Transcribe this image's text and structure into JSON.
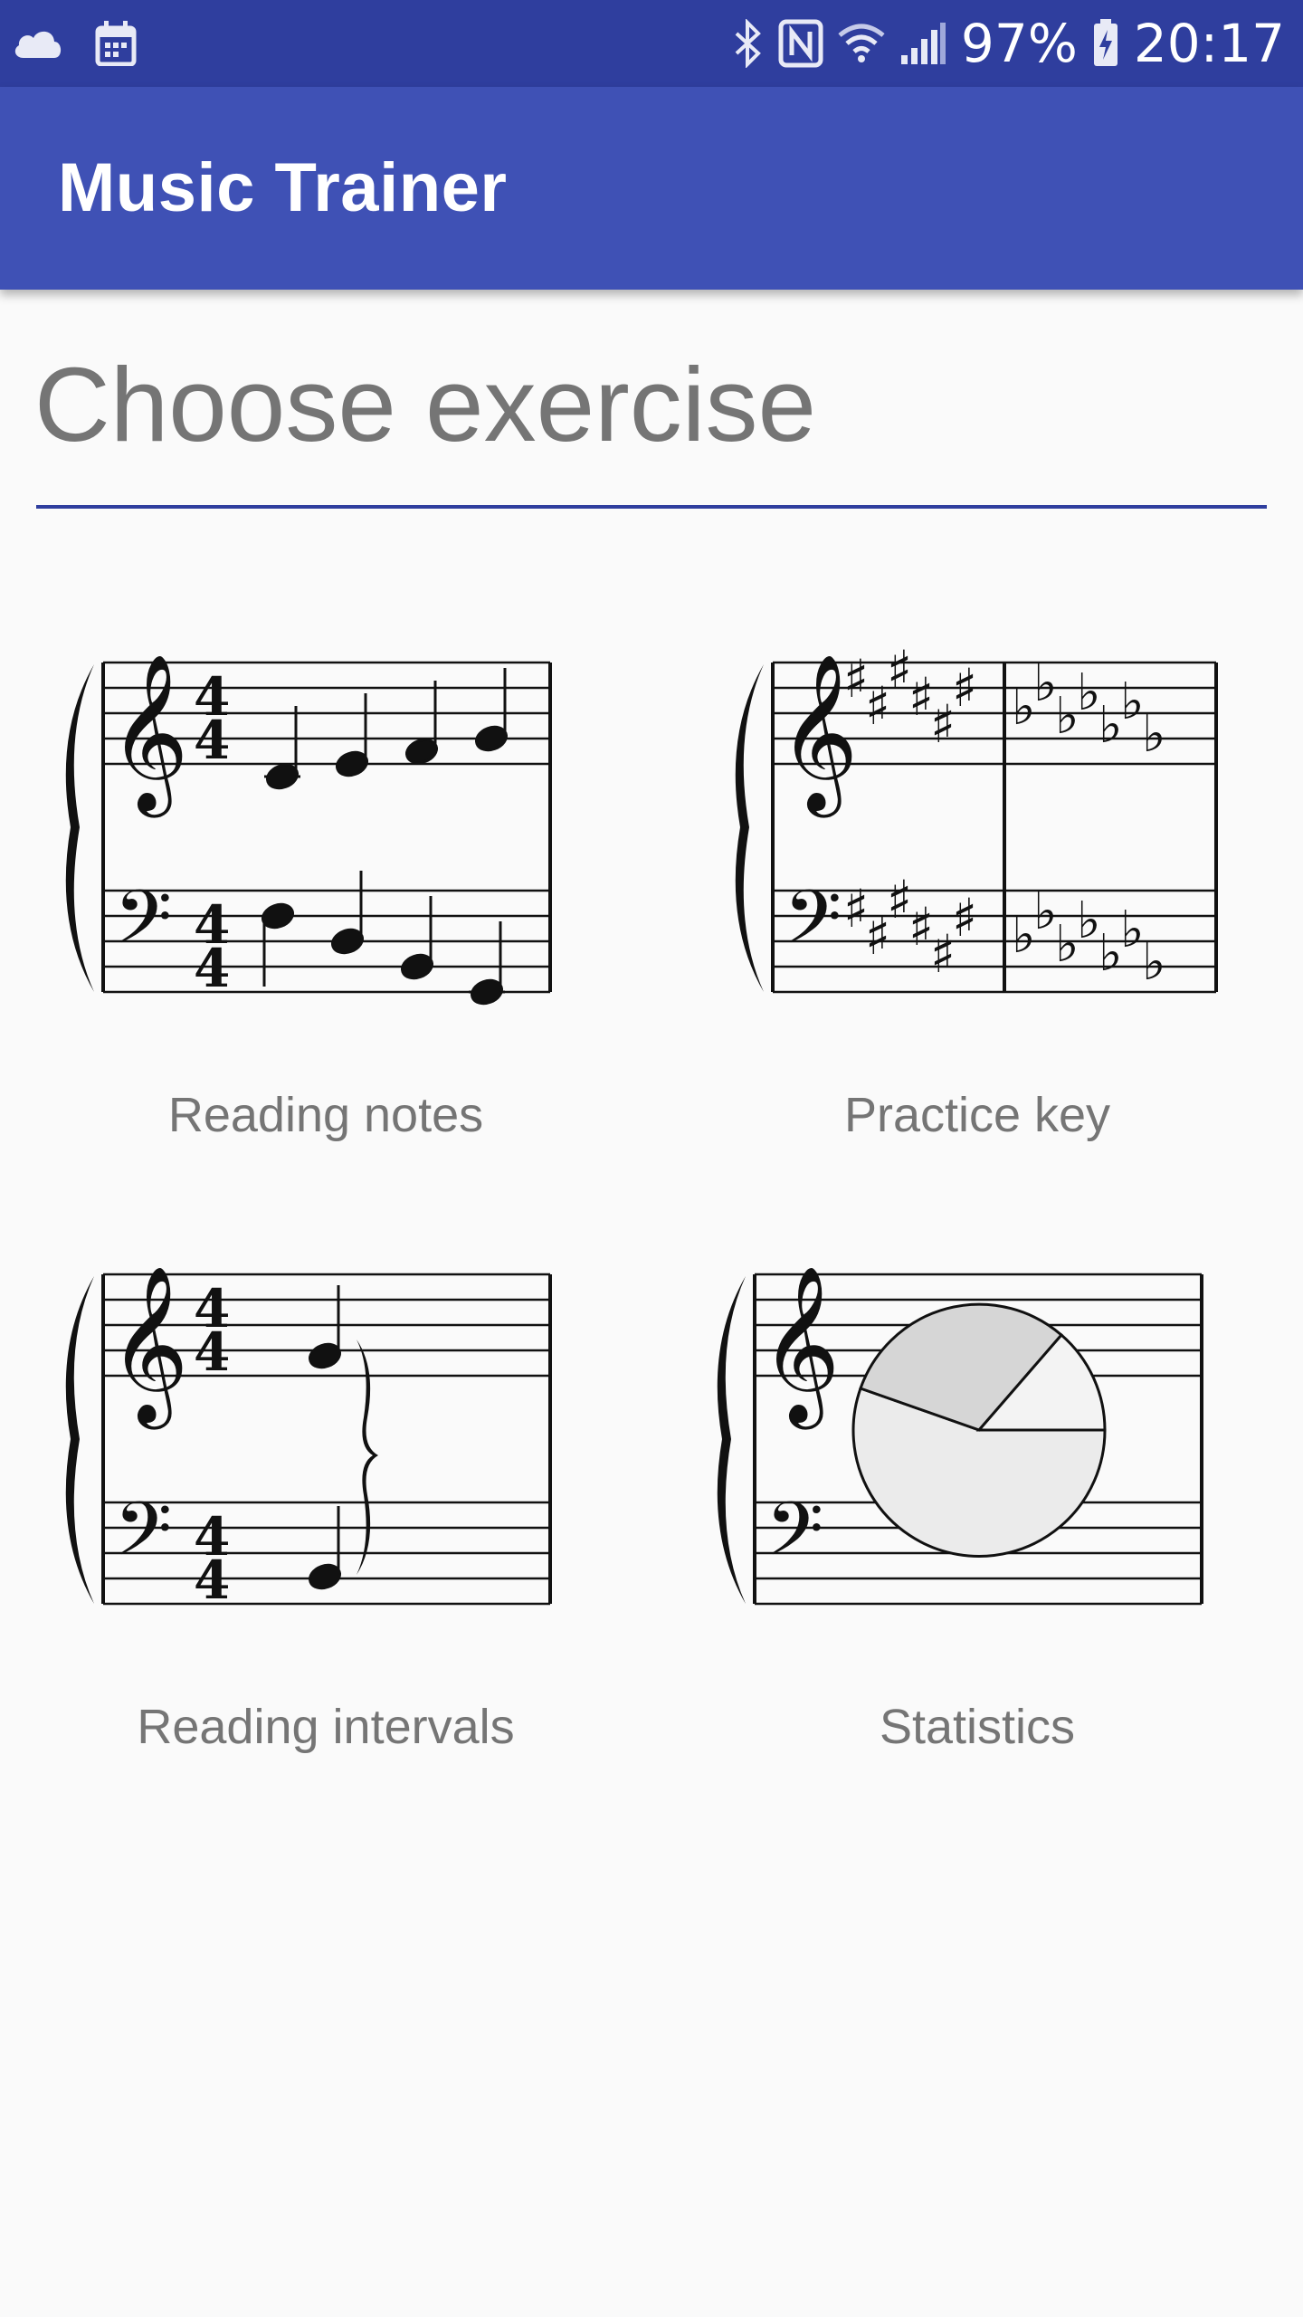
{
  "status_bar": {
    "battery": "97%",
    "time": "20:17",
    "icons": [
      "cloud-icon",
      "calendar-icon",
      "bluetooth-icon",
      "nfc-icon",
      "wifi-icon",
      "signal-icon",
      "battery-charging-icon"
    ]
  },
  "app_bar": {
    "title": "Music Trainer"
  },
  "page": {
    "heading": "Choose exercise"
  },
  "exercises": [
    {
      "label": "Reading notes",
      "icon": "reading-notes-icon"
    },
    {
      "label": "Practice key",
      "icon": "practice-key-icon"
    },
    {
      "label": "Reading intervals",
      "icon": "reading-intervals-icon"
    },
    {
      "label": "Statistics",
      "icon": "statistics-pie-icon"
    }
  ],
  "colors": {
    "status_bar": "#2f3e9e",
    "app_bar": "#3f51b5",
    "background": "#fafafa",
    "text_secondary": "#757575"
  }
}
